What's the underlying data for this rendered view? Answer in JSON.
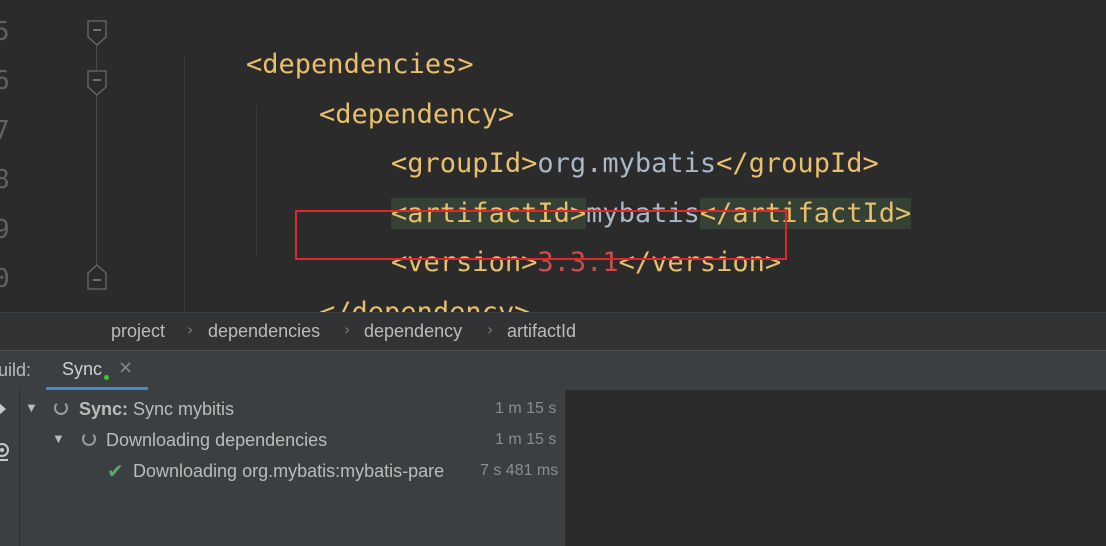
{
  "editor": {
    "line_numbers": [
      "5",
      "6",
      "7",
      "8",
      "9",
      "0"
    ],
    "lines": [
      {
        "open": "<dependencies>"
      },
      {
        "open": "<dependency>"
      },
      {
        "open": "<groupId>",
        "text": "org.mybatis",
        "close": "</groupId>"
      },
      {
        "open": "<artifactId>",
        "text": "mybatis",
        "close": "</artifactId>"
      },
      {
        "open": "<version>",
        "value": "3.3.1",
        "close": "</version>"
      },
      {
        "close": "</dependency>"
      }
    ]
  },
  "breadcrumb": [
    "project",
    "dependencies",
    "dependency",
    "artifactId"
  ],
  "build": {
    "label": "uild:",
    "tab_label": "Sync",
    "close_glyph": "×",
    "tree": [
      {
        "bold": "Sync:",
        "text": " Sync mybitis",
        "time": "1 m 15 s"
      },
      {
        "text": "Downloading dependencies",
        "time": "1 m 15 s"
      },
      {
        "text": "Downloading org.mybatis:mybatis-pare",
        "time": "7 s 481 ms"
      }
    ]
  },
  "colors": {
    "tag": "#e8bf6a",
    "text": "#a9b7c6",
    "number": "#cc4c4c",
    "highlight_box": "#e0262a",
    "tab_accent": "#4a88c7",
    "success": "#59a869"
  }
}
